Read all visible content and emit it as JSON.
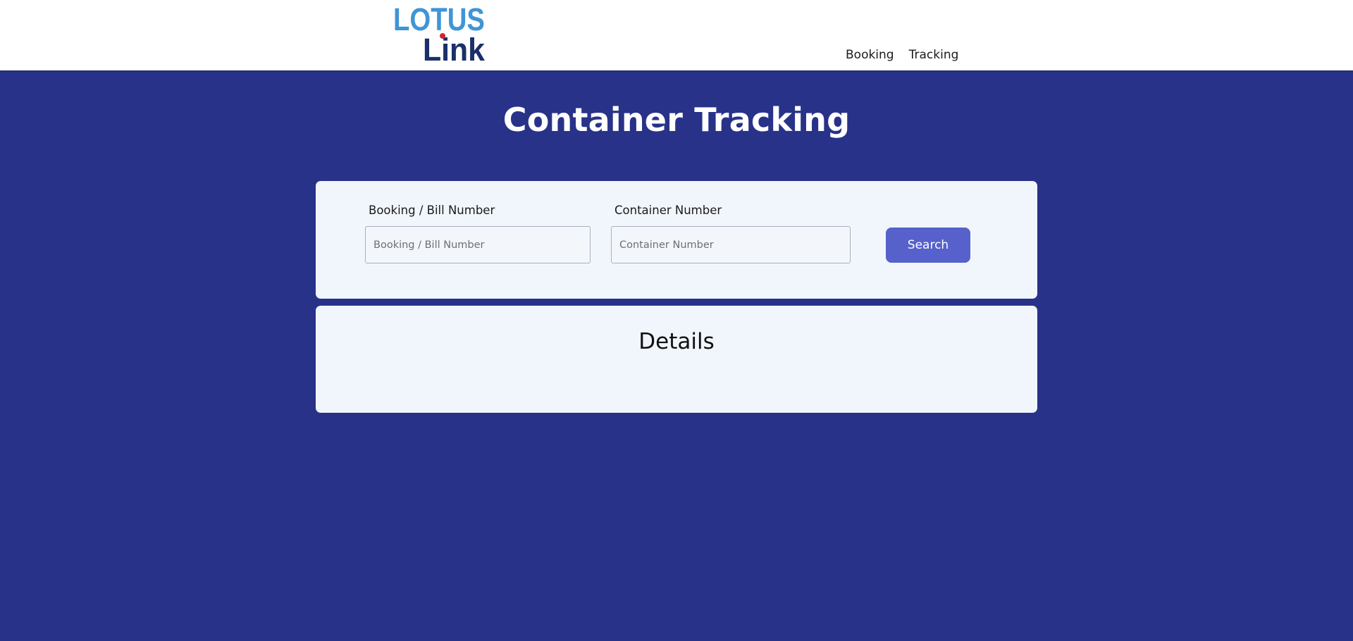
{
  "brand": {
    "logo_line1": "LOTUS",
    "logo_line2": "Link",
    "colors": {
      "light_blue": "#3f95d6",
      "dark_navy": "#1b2f6b",
      "red_dot": "#d3262e"
    }
  },
  "nav": {
    "items": [
      {
        "label": "Booking"
      },
      {
        "label": "Tracking"
      }
    ]
  },
  "page": {
    "title": "Container Tracking",
    "background_color": "#283289"
  },
  "search_form": {
    "booking_label": "Booking / Bill Number",
    "booking_placeholder": "Booking / Bill Number",
    "booking_value": "",
    "container_label": "Container Number",
    "container_placeholder": "Container Number",
    "container_value": "",
    "search_label": "Search",
    "button_color": "#5661cc"
  },
  "details": {
    "title": "Details"
  }
}
